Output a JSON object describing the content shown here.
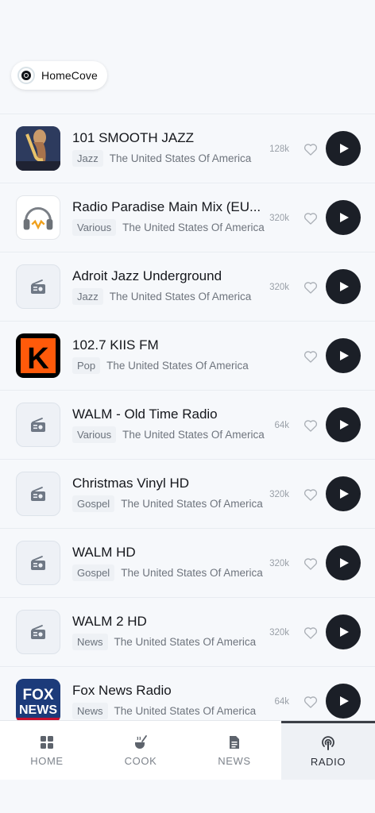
{
  "brand": {
    "name": "HomeCove",
    "icon": "vinyl-logo-icon"
  },
  "stations": [
    {
      "title": "101 SMOOTH JAZZ",
      "genre": "Jazz",
      "country": "The United States Of America",
      "bitrate": "128k",
      "art": "jazz"
    },
    {
      "title": "Radio Paradise Main Mix (EU...",
      "genre": "Various",
      "country": "The United States Of America",
      "bitrate": "320k",
      "art": "paradise"
    },
    {
      "title": "Adroit Jazz Underground",
      "genre": "Jazz",
      "country": "The United States Of America",
      "bitrate": "320k",
      "art": "placeholder"
    },
    {
      "title": "102.7 KIIS FM",
      "genre": "Pop",
      "country": "The United States Of America",
      "bitrate": "",
      "art": "kiis"
    },
    {
      "title": "WALM - Old Time Radio",
      "genre": "Various",
      "country": "The United States Of America",
      "bitrate": "64k",
      "art": "placeholder"
    },
    {
      "title": "Christmas Vinyl HD",
      "genre": "Gospel",
      "country": "The United States Of America",
      "bitrate": "320k",
      "art": "placeholder"
    },
    {
      "title": "WALM HD",
      "genre": "Gospel",
      "country": "The United States Of America",
      "bitrate": "320k",
      "art": "placeholder"
    },
    {
      "title": "WALM 2 HD",
      "genre": "News",
      "country": "The United States Of America",
      "bitrate": "320k",
      "art": "placeholder"
    },
    {
      "title": "Fox News Radio",
      "genre": "News",
      "country": "The United States Of America",
      "bitrate": "64k",
      "art": "fox"
    }
  ],
  "art_text": {
    "kiis": "K",
    "fox_top": "FOX",
    "fox_bottom": "NEWS"
  },
  "tabs": [
    {
      "label": "HOME",
      "icon": "grid-icon",
      "active": false
    },
    {
      "label": "COOK",
      "icon": "cooking-pot-icon",
      "active": false
    },
    {
      "label": "NEWS",
      "icon": "newspaper-icon",
      "active": false
    },
    {
      "label": "RADIO",
      "icon": "podcast-icon",
      "active": true
    }
  ],
  "colors": {
    "accent": "#1b1f27",
    "background": "#f6f8fb",
    "kiis": "#ff5a0a"
  }
}
